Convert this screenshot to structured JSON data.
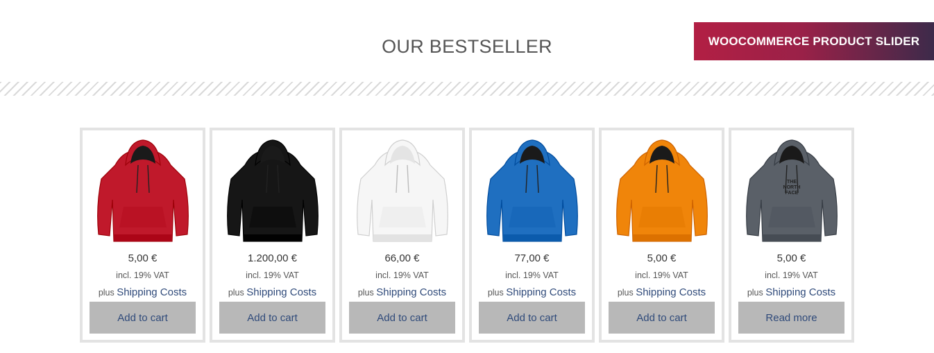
{
  "badge": {
    "label": "WOOCOMMERCE PRODUCT SLIDER"
  },
  "section": {
    "title": "OUR BESTSELLER"
  },
  "products": [
    {
      "price": "5,00 €",
      "vat": "incl. 19% VAT",
      "shipping_prefix": "plus",
      "shipping_link": "Shipping Costs",
      "button": "Add to cart",
      "color": "#c0192b",
      "logo": ""
    },
    {
      "price": "1.200,00 €",
      "vat": "incl. 19% VAT",
      "shipping_prefix": "plus",
      "shipping_link": "Shipping Costs",
      "button": "Add to cart",
      "color": "#161616",
      "logo": ""
    },
    {
      "price": "66,00 €",
      "vat": "incl. 19% VAT",
      "shipping_prefix": "plus",
      "shipping_link": "Shipping Costs",
      "button": "Add to cart",
      "color": "#f6f6f6",
      "logo": ""
    },
    {
      "price": "77,00 €",
      "vat": "incl. 19% VAT",
      "shipping_prefix": "plus",
      "shipping_link": "Shipping Costs",
      "button": "Add to cart",
      "color": "#1f6fc0",
      "logo": ""
    },
    {
      "price": "5,00 €",
      "vat": "incl. 19% VAT",
      "shipping_prefix": "plus",
      "shipping_link": "Shipping Costs",
      "button": "Add to cart",
      "color": "#f0850a",
      "logo": ""
    },
    {
      "price": "5,00 €",
      "vat": "incl. 19% VAT",
      "shipping_prefix": "plus",
      "shipping_link": "Shipping Costs",
      "button": "Read more",
      "color": "#5a6068",
      "logo": "THE NORTH FACE"
    }
  ]
}
